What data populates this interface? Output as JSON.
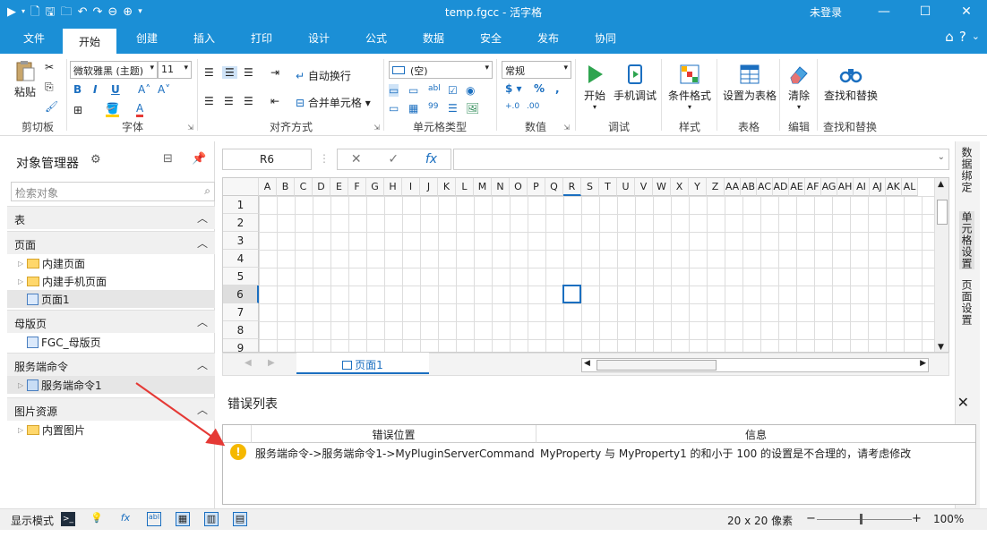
{
  "window": {
    "title": "temp.fgcc - 活字格",
    "login_status": "未登录",
    "minimize_icon": "minimize-icon",
    "maximize_icon": "maximize-icon",
    "close_icon": "close-icon"
  },
  "menu": {
    "tabs": [
      "文件",
      "开始",
      "创建",
      "插入",
      "打印",
      "设计",
      "公式",
      "数据",
      "安全",
      "发布",
      "协同"
    ],
    "active": "开始"
  },
  "ribbon": {
    "clipboard": {
      "paste": "粘贴",
      "label": "剪切板"
    },
    "font": {
      "name": "微软雅黑 (主题)",
      "size": "11",
      "bold": "B",
      "italic": "I",
      "underline": "U",
      "label": "字体"
    },
    "align": {
      "wrap": "自动换行",
      "merge": "合并单元格",
      "label": "对齐方式"
    },
    "celltype": {
      "value": "(空)",
      "label": "单元格类型"
    },
    "number": {
      "format": "常规",
      "label": "数值"
    },
    "debug": {
      "start": "开始",
      "mobile": "手机调试",
      "label": "调试"
    },
    "style": {
      "cond": "条件格式",
      "label": "样式"
    },
    "table": {
      "settable": "设置为表格",
      "label": "表格"
    },
    "edit": {
      "clear": "清除",
      "label": "编辑"
    },
    "find": {
      "findreplace": "查找和替换",
      "label": "查找和替换"
    }
  },
  "object_manager": {
    "title": "对象管理器",
    "search_placeholder": "检索对象",
    "sections": [
      {
        "label": "表",
        "items": []
      },
      {
        "label": "页面",
        "items": [
          "内建页面",
          "内建手机页面",
          "页面1"
        ]
      },
      {
        "label": "母版页",
        "items": [
          "FGC_母版页"
        ]
      },
      {
        "label": "服务端命令",
        "items": [
          "服务端命令1"
        ]
      },
      {
        "label": "图片资源",
        "items": [
          "内置图片"
        ]
      }
    ]
  },
  "formula_bar": {
    "cell_ref": "R6",
    "fx": "fx"
  },
  "grid": {
    "columns": [
      "A",
      "B",
      "C",
      "D",
      "E",
      "F",
      "G",
      "H",
      "I",
      "J",
      "K",
      "L",
      "M",
      "N",
      "O",
      "P",
      "Q",
      "R",
      "S",
      "T",
      "U",
      "V",
      "W",
      "X",
      "Y",
      "Z",
      "AA",
      "AB",
      "AC",
      "AD",
      "AE",
      "AF",
      "AG",
      "AH",
      "AI",
      "AJ",
      "AK",
      "AL"
    ],
    "selected_column": "R",
    "rows": [
      "1",
      "2",
      "3",
      "4",
      "5",
      "6",
      "7",
      "8",
      "9"
    ],
    "selected_row": "6",
    "sheet_tab": "页面1"
  },
  "right_tabs": [
    "数据绑定",
    "单元格设置",
    "页面设置"
  ],
  "error_list": {
    "title": "错误列表",
    "headers": [
      "错误位置",
      "信息"
    ],
    "rows": [
      {
        "location": "服务端命令->服务端命令1->MyPluginServerCommand",
        "message": "MyProperty 与 MyProperty1 的和小于 100 的设置是不合理的，请考虑修改"
      }
    ]
  },
  "status": {
    "display_mode": "显示模式",
    "pixel_info": "20 x 20 像素",
    "zoom": "100%",
    "zoom_value": 100
  },
  "colors": {
    "accent": "#1b8fd6",
    "selection": "#1b6fc0",
    "warning": "#f5b800",
    "annotation_arrow": "#e53935"
  }
}
